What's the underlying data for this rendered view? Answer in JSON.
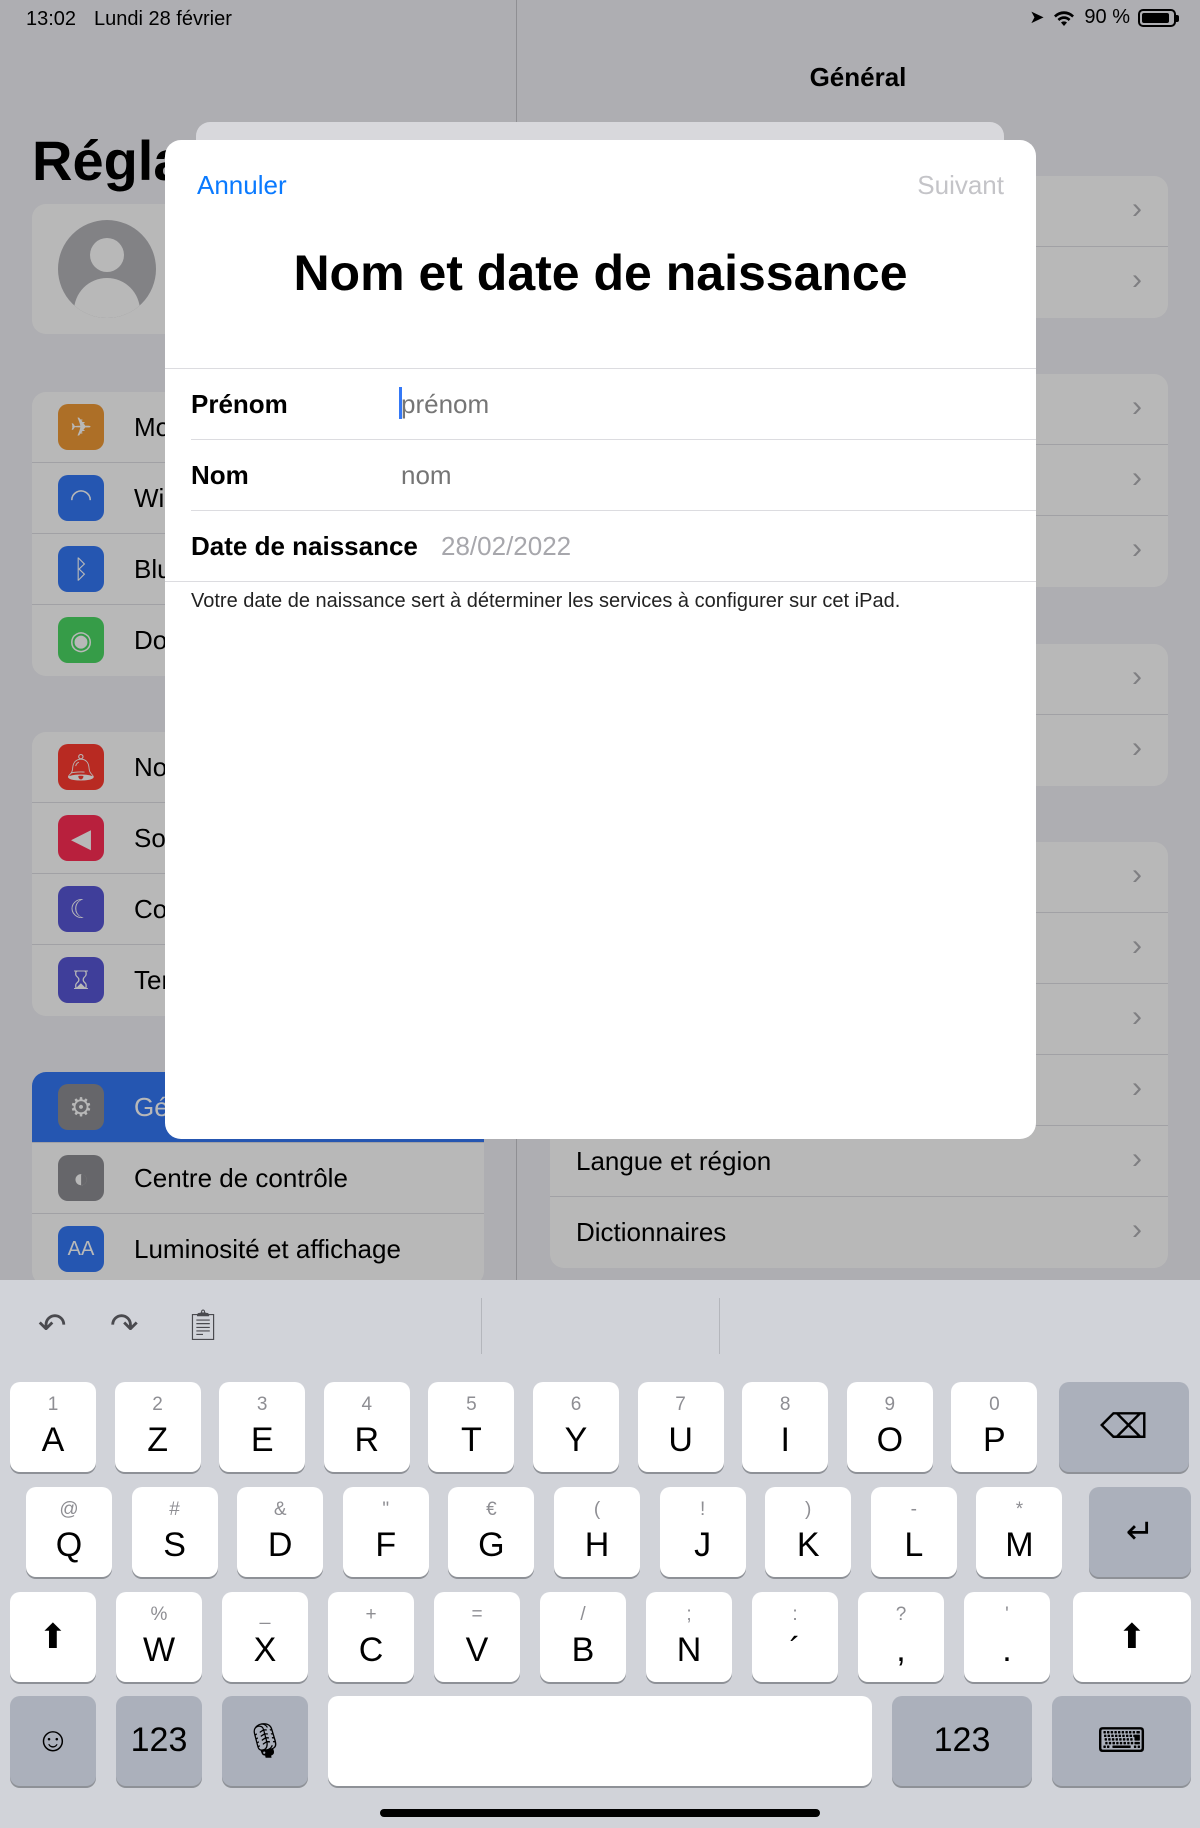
{
  "status_bar": {
    "time": "13:02",
    "date": "Lundi 28 février",
    "battery": "90 %",
    "battery_level": 0.9
  },
  "left_pane": {
    "title": "Régla",
    "group1": [
      {
        "label": "Mo",
        "icon": "airplane-icon",
        "color": "#f09a37"
      },
      {
        "label": "Wi-",
        "icon": "wifi-icon",
        "color": "#3478f6"
      },
      {
        "label": "Blu",
        "icon": "bluetooth-icon",
        "color": "#3478f6"
      },
      {
        "label": "Do",
        "icon": "cellular-icon",
        "color": "#4cd964"
      }
    ],
    "group2": [
      {
        "label": "No",
        "icon": "notification-icon",
        "color": "#ff3b30"
      },
      {
        "label": "Sor",
        "icon": "speaker-icon",
        "color": "#ff2d55"
      },
      {
        "label": "Co",
        "icon": "moon-icon",
        "color": "#5856d6"
      },
      {
        "label": "Ter",
        "icon": "hourglass-icon",
        "color": "#5856d6"
      }
    ],
    "group3": [
      {
        "label": "Gé",
        "icon": "gear-icon",
        "color": "#8e8e93"
      },
      {
        "label": "Centre de contrôle",
        "icon": "toggles-icon",
        "color": "#8e8e93"
      },
      {
        "label": "Luminosité et affichage",
        "icon": "text-size-icon",
        "color": "#3478f6"
      }
    ]
  },
  "right_pane": {
    "title": "Général",
    "items": [
      "Langue et région",
      "Dictionnaires"
    ]
  },
  "sheet": {
    "cancel_label": "Annuler",
    "next_label": "Suivant",
    "title": "Nom et date de naissance",
    "fields": {
      "first_name_label": "Prénom",
      "first_name_placeholder": "prénom",
      "last_name_label": "Nom",
      "last_name_placeholder": "nom",
      "birthdate_label": "Date de naissance",
      "birthdate_value": "28/02/2022"
    },
    "footnote": "Votre date de naissance sert à déterminer les services à configurer sur cet iPad."
  },
  "keyboard": {
    "toolbar": [
      "undo-icon",
      "redo-icon",
      "paste-icon"
    ],
    "row1": [
      {
        "sub": "1",
        "main": "A"
      },
      {
        "sub": "2",
        "main": "Z"
      },
      {
        "sub": "3",
        "main": "E"
      },
      {
        "sub": "4",
        "main": "R"
      },
      {
        "sub": "5",
        "main": "T"
      },
      {
        "sub": "6",
        "main": "Y"
      },
      {
        "sub": "7",
        "main": "U"
      },
      {
        "sub": "8",
        "main": "I"
      },
      {
        "sub": "9",
        "main": "O"
      },
      {
        "sub": "0",
        "main": "P"
      }
    ],
    "row2": [
      {
        "sub": "@",
        "main": "Q"
      },
      {
        "sub": "#",
        "main": "S"
      },
      {
        "sub": "&",
        "main": "D"
      },
      {
        "sub": "\"",
        "main": "F"
      },
      {
        "sub": "€",
        "main": "G"
      },
      {
        "sub": "(",
        "main": "H"
      },
      {
        "sub": "!",
        "main": "J"
      },
      {
        "sub": ")",
        "main": "K"
      },
      {
        "sub": "-",
        "main": "L"
      },
      {
        "sub": "*",
        "main": "M"
      }
    ],
    "row3": [
      {
        "sub": "%",
        "main": "W"
      },
      {
        "sub": "_",
        "main": "X"
      },
      {
        "sub": "+",
        "main": "C"
      },
      {
        "sub": "=",
        "main": "V"
      },
      {
        "sub": "/",
        "main": "B"
      },
      {
        "sub": ";",
        "main": "N"
      },
      {
        "sub": ":",
        "main": "´"
      },
      {
        "sub": "?",
        "main": ","
      },
      {
        "sub": "'",
        "main": "."
      }
    ],
    "numbers_label": "123"
  }
}
